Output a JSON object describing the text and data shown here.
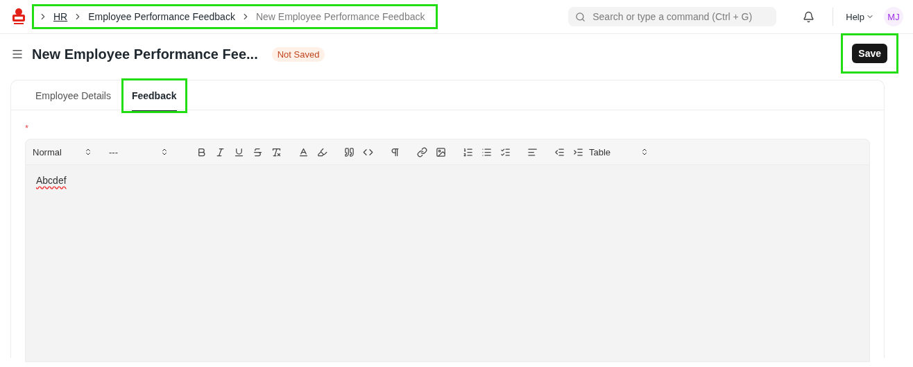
{
  "navbar": {
    "breadcrumbs": [
      {
        "label": "HR",
        "kind": "link"
      },
      {
        "label": "Employee Performance Feedback",
        "kind": "link"
      },
      {
        "label": "New Employee Performance Feedback",
        "kind": "current"
      }
    ],
    "breadcrumbs_highlighted": true,
    "search": {
      "placeholder": "Search or type a command (Ctrl + G)"
    },
    "help": "Help",
    "avatar": "MJ"
  },
  "page": {
    "title": "New Employee Performance Fee...",
    "status": "Not Saved",
    "save_button": {
      "label": "Save",
      "highlighted": true
    }
  },
  "tabs": [
    {
      "label": "Employee Details",
      "selected": false,
      "highlighted": false
    },
    {
      "label": "Feedback",
      "selected": true,
      "highlighted": true
    }
  ],
  "field": {
    "required_mark": "*",
    "editor": {
      "toolbar": [
        {
          "kind": "select",
          "label": "Normal"
        },
        {
          "kind": "select",
          "label": "---"
        },
        {
          "kind": "bold"
        },
        {
          "kind": "italic"
        },
        {
          "kind": "underline"
        },
        {
          "kind": "strike"
        },
        {
          "kind": "clean"
        },
        {
          "kind": "color"
        },
        {
          "kind": "background"
        },
        {
          "kind": "quote"
        },
        {
          "kind": "code"
        },
        {
          "kind": "direction"
        },
        {
          "kind": "link"
        },
        {
          "kind": "image"
        },
        {
          "kind": "ordered"
        },
        {
          "kind": "bullet"
        },
        {
          "kind": "check"
        },
        {
          "kind": "align"
        },
        {
          "kind": "outdent"
        },
        {
          "kind": "indent"
        },
        {
          "kind": "select",
          "label": "Table"
        }
      ],
      "value": "Abcdef",
      "misspelled": true
    }
  }
}
